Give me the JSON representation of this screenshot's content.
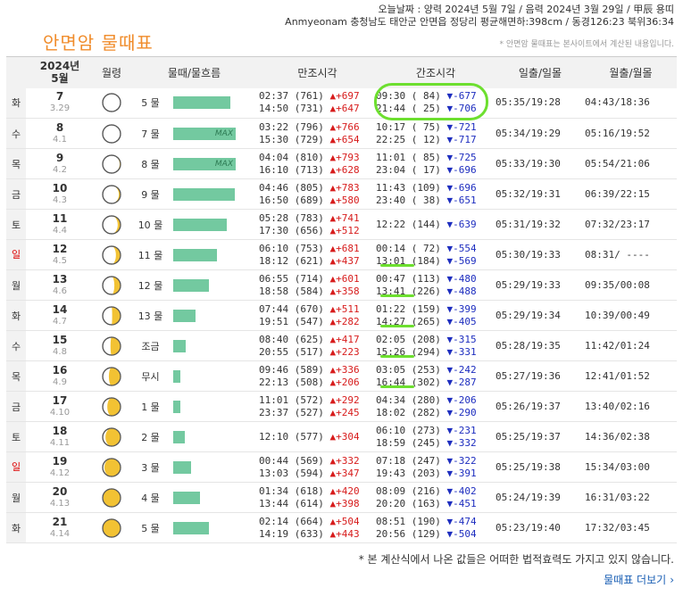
{
  "header": {
    "today_line": "오늘날짜 : 양력 2024년 5월 7일 / 음력 2024년 3월 29일 / 甲辰 용띠",
    "location_line": "Anmyeonam 충청남도 태안군 안면읍 정당리 평균해면하:398cm / 동경126:23 북위36:34"
  },
  "title": "안면암 물때표",
  "note_top": "* 안면암 물때표는 본사이트에서 계산된 내용입니다.",
  "columns": {
    "date_year": "2024년",
    "date_month": "5월",
    "moon_age": "월령",
    "tide_flow": "물때/물흐름",
    "high_tide": "만조시각",
    "low_tide": "간조시각",
    "sunrise_set": "일출/일몰",
    "moonrise_set": "월출/월몰"
  },
  "max_label": "MAX",
  "rows": [
    {
      "dow": "화",
      "day": "7",
      "lunar": "3.29",
      "phase": 0.97,
      "mul": "5 물",
      "flow": 0.92,
      "h1": "02:37 (761)",
      "h1d": "▲+697",
      "h2": "14:50 (731)",
      "h2d": "▲+647",
      "l1": "09:30 ( 84)",
      "l1d": "▼-677",
      "l2": "21:44 ( 25)",
      "l2d": "▼-706",
      "sun": "05:35/19:28",
      "moon": "04:43/18:36"
    },
    {
      "dow": "수",
      "day": "8",
      "lunar": "4.1",
      "phase": 0.03,
      "mul": "7 물",
      "flow": 1.0,
      "max": true,
      "h1": "03:22 (796)",
      "h1d": "▲+766",
      "h2": "15:30 (729)",
      "h2d": "▲+654",
      "l1": "10:17 ( 75)",
      "l1d": "▼-721",
      "l2": "22:25 ( 12)",
      "l2d": "▼-717",
      "sun": "05:34/19:29",
      "moon": "05:16/19:52"
    },
    {
      "dow": "목",
      "day": "9",
      "lunar": "4.2",
      "phase": 0.07,
      "mul": "8 물",
      "flow": 1.0,
      "max": true,
      "h1": "04:04 (810)",
      "h1d": "▲+793",
      "h2": "16:10 (713)",
      "h2d": "▲+628",
      "l1": "11:01 ( 85)",
      "l1d": "▼-725",
      "l2": "23:04 ( 17)",
      "l2d": "▼-696",
      "sun": "05:33/19:30",
      "moon": "05:54/21:06"
    },
    {
      "dow": "금",
      "day": "10",
      "lunar": "4.3",
      "phase": 0.1,
      "mul": "9 물",
      "flow": 0.99,
      "h1": "04:46 (805)",
      "h1d": "▲+783",
      "h2": "16:50 (689)",
      "h2d": "▲+580",
      "l1": "11:43 (109)",
      "l1d": "▼-696",
      "l2": "23:40 ( 38)",
      "l2d": "▼-651",
      "sun": "05:32/19:31",
      "moon": "06:39/22:15"
    },
    {
      "dow": "토",
      "day": "11",
      "lunar": "4.4",
      "phase": 0.13,
      "mul": "10 물",
      "flow": 0.85,
      "h1": "05:28 (783)",
      "h1d": "▲+741",
      "h2": "17:30 (656)",
      "h2d": "▲+512",
      "l1": "12:22 (144)",
      "l1d": "▼-639",
      "l2": "",
      "l2d": "",
      "sun": "05:31/19:32",
      "moon": "07:32/23:17"
    },
    {
      "dow": "일",
      "day": "12",
      "lunar": "4.5",
      "phase": 0.17,
      "mul": "11 물",
      "flow": 0.7,
      "sunday": true,
      "h1": "06:10 (753)",
      "h1d": "▲+681",
      "h2": "18:12 (621)",
      "h2d": "▲+437",
      "l1": "00:14 ( 72)",
      "l1d": "▼-554",
      "l2": "13:01 (184)",
      "l2d": "▼-569",
      "sun": "05:30/19:33",
      "moon": "08:31/ ----"
    },
    {
      "dow": "월",
      "day": "13",
      "lunar": "4.6",
      "phase": 0.2,
      "mul": "12 물",
      "flow": 0.57,
      "h1": "06:55 (714)",
      "h1d": "▲+601",
      "h2": "18:58 (584)",
      "h2d": "▲+358",
      "l1": "00:47 (113)",
      "l1d": "▼-480",
      "l2": "13:41 (226)",
      "l2d": "▼-488",
      "sun": "05:29/19:33",
      "moon": "09:35/00:08"
    },
    {
      "dow": "화",
      "day": "14",
      "lunar": "4.7",
      "phase": 0.24,
      "mul": "13 물",
      "flow": 0.36,
      "h1": "07:44 (670)",
      "h1d": "▲+511",
      "h2": "19:51 (547)",
      "h2d": "▲+282",
      "l1": "01:22 (159)",
      "l1d": "▼-399",
      "l2": "14:27 (265)",
      "l2d": "▼-405",
      "sun": "05:29/19:34",
      "moon": "10:39/00:49"
    },
    {
      "dow": "수",
      "day": "15",
      "lunar": "4.8",
      "phase": 0.27,
      "mul": "조금",
      "flow": 0.2,
      "h1": "08:40 (625)",
      "h1d": "▲+417",
      "h2": "20:55 (517)",
      "h2d": "▲+223",
      "l1": "02:05 (208)",
      "l1d": "▼-315",
      "l2": "15:26 (294)",
      "l2d": "▼-331",
      "sun": "05:28/19:35",
      "moon": "11:42/01:24"
    },
    {
      "dow": "목",
      "day": "16",
      "lunar": "4.9",
      "phase": 0.3,
      "mul": "무시",
      "flow": 0.12,
      "h1": "09:46 (589)",
      "h1d": "▲+336",
      "h2": "22:13 (508)",
      "h2d": "▲+206",
      "l1": "03:05 (253)",
      "l1d": "▼-242",
      "l2": "16:44 (302)",
      "l2d": "▼-287",
      "sun": "05:27/19:36",
      "moon": "12:41/01:52"
    },
    {
      "dow": "금",
      "day": "17",
      "lunar": "4.10",
      "phase": 0.33,
      "mul": "1 물",
      "flow": 0.12,
      "h1": "11:01 (572)",
      "h1d": "▲+292",
      "h2": "23:37 (527)",
      "h2d": "▲+245",
      "l1": "04:34 (280)",
      "l1d": "▼-206",
      "l2": "18:02 (282)",
      "l2d": "▼-290",
      "sun": "05:26/19:37",
      "moon": "13:40/02:16"
    },
    {
      "dow": "토",
      "day": "18",
      "lunar": "4.11",
      "phase": 0.37,
      "mul": "2 물",
      "flow": 0.19,
      "h1": "12:10 (577)",
      "h1d": "▲+304",
      "h2": "",
      "h2d": "",
      "l1": "06:10 (273)",
      "l1d": "▼-231",
      "l2": "18:59 (245)",
      "l2d": "▼-332",
      "sun": "05:25/19:37",
      "moon": "14:36/02:38"
    },
    {
      "dow": "일",
      "day": "19",
      "lunar": "4.12",
      "phase": 0.4,
      "mul": "3 물",
      "flow": 0.29,
      "sunday": true,
      "h1": "00:44 (569)",
      "h1d": "▲+332",
      "h2": "13:03 (594)",
      "h2d": "▲+347",
      "l1": "07:18 (247)",
      "l1d": "▼-322",
      "l2": "19:43 (203)",
      "l2d": "▼-391",
      "sun": "05:25/19:38",
      "moon": "15:34/03:00"
    },
    {
      "dow": "월",
      "day": "20",
      "lunar": "4.13",
      "phase": 0.44,
      "mul": "4 물",
      "flow": 0.43,
      "h1": "01:34 (618)",
      "h1d": "▲+420",
      "h2": "13:44 (614)",
      "h2d": "▲+398",
      "l1": "08:09 (216)",
      "l1d": "▼-402",
      "l2": "20:20 (163)",
      "l2d": "▼-451",
      "sun": "05:24/19:39",
      "moon": "16:31/03:22"
    },
    {
      "dow": "화",
      "day": "21",
      "lunar": "4.14",
      "phase": 0.47,
      "mul": "5 물",
      "flow": 0.57,
      "h1": "02:14 (664)",
      "h1d": "▲+504",
      "h2": "14:19 (633)",
      "h2d": "▲+443",
      "l1": "08:51 (190)",
      "l1d": "▼-474",
      "l2": "20:56 (129)",
      "l2d": "▼-504",
      "sun": "05:23/19:40",
      "moon": "17:32/03:45"
    }
  ],
  "disclaimer": "* 본 계산식에서 나온 값들은 어떠한 법적효력도 가지고 있지 않습니다.",
  "more_link": "물때표 더보기",
  "colors": {
    "title": "#f08c2b",
    "bar": "#73c9a0",
    "up": "#d71c1c",
    "down": "#1d2dbf",
    "highlight": "#6ddf2f",
    "link": "#1a5fb4"
  }
}
